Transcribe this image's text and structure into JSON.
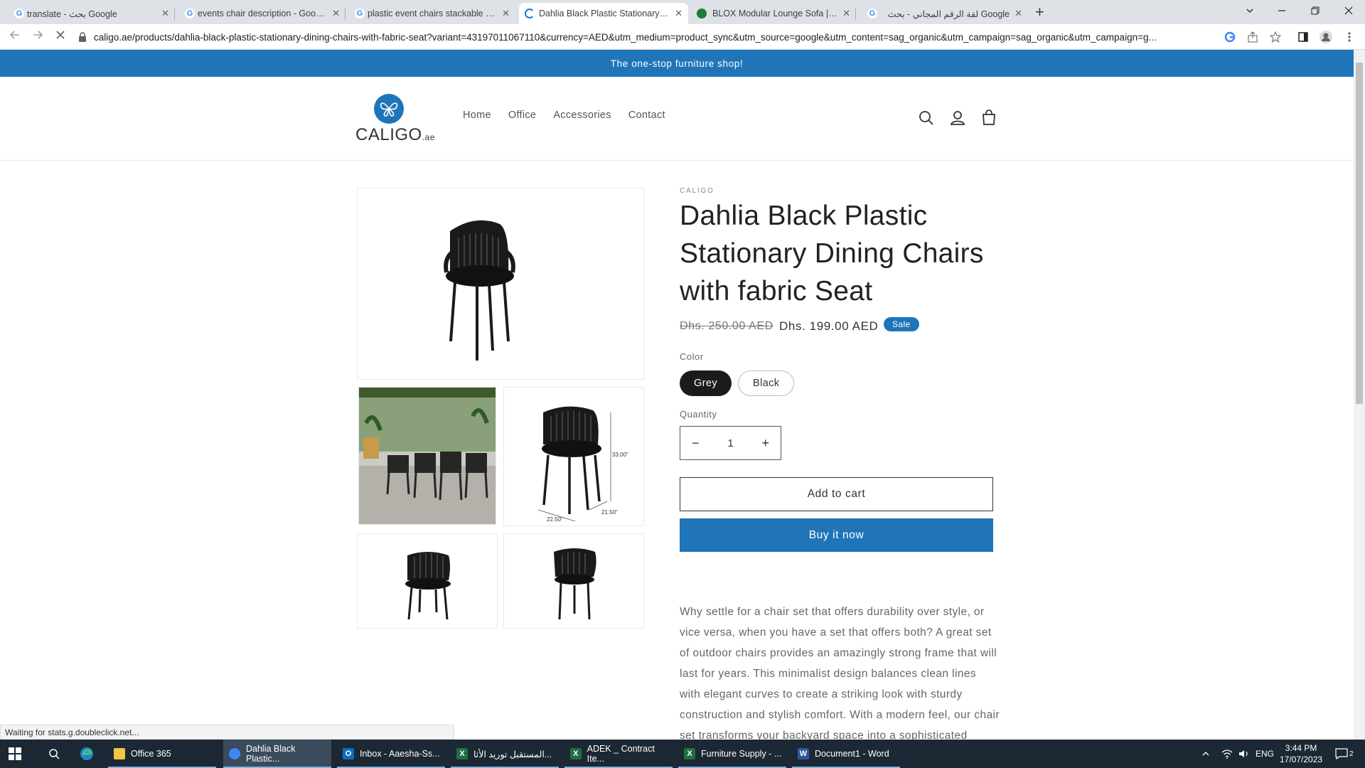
{
  "browser": {
    "tabs": [
      {
        "title": "translate - بحث Google",
        "favicon": "google-icon",
        "active": false
      },
      {
        "title": "events chair description - Google",
        "favicon": "google-icon",
        "active": false
      },
      {
        "title": "plastic event chairs stackable bla",
        "favicon": "google-icon",
        "active": false
      },
      {
        "title": "Dahlia Black Plastic Stationary Di",
        "favicon": "loading-spinner-icon",
        "active": true
      },
      {
        "title": "BLOX Modular Lounge Sofa | Offi",
        "favicon": "sheet-icon",
        "active": false
      },
      {
        "title": "لقة الرقم المجاني - بحث Google",
        "favicon": "google-icon",
        "active": false
      }
    ],
    "close_glyph": "✕",
    "new_tab_glyph": "+",
    "url": "caligo.ae/products/dahlia-black-plastic-stationary-dining-chairs-with-fabric-seat?variant=43197011067110&currency=AED&utm_medium=product_sync&utm_source=google&utm_content=sag_organic&utm_campaign=sag_organic&utm_campaign=g...",
    "status_text": "Waiting for stats.g.doubleclick.net..."
  },
  "site": {
    "announcement": "The one-stop furniture shop!",
    "logo_text": "CALIGO",
    "logo_suffix": ".ae",
    "nav": [
      "Home",
      "Office",
      "Accessories",
      "Contact"
    ]
  },
  "product": {
    "vendor": "CALIGO",
    "title": "Dahlia Black Plastic Stationary Dining Chairs with fabric Seat",
    "price_regular": "Dhs. 250.00 AED",
    "price_sale": "Dhs. 199.00 AED",
    "sale_badge": "Sale",
    "color_label": "Color",
    "colors": [
      {
        "name": "Grey",
        "selected": true
      },
      {
        "name": "Black",
        "selected": false
      }
    ],
    "quantity_label": "Quantity",
    "quantity": "1",
    "qty_minus": "−",
    "qty_plus": "+",
    "add_to_cart": "Add to cart",
    "buy_now": "Buy it now",
    "description": "Why settle for a chair set that offers durability over style, or vice versa, when you have a set that offers both? A great set of outdoor chairs provides an amazingly strong frame that will last for years. This minimalist design balances clean lines with elegant curves to create a striking look with sturdy construction and stylish comfort. With a modern feel, our chair set transforms your backyard space into a sophisticated",
    "dimensions": {
      "height": "33.00\"",
      "width": "22.50\"",
      "depth": "21.50\""
    }
  },
  "taskbar": {
    "apps": [
      {
        "label": "Office 365",
        "icon": "folder-icon",
        "color": "#f2c744",
        "active": false
      },
      {
        "label": "Dahlia Black Plastic...",
        "icon": "chrome-icon",
        "color": "#4285f4",
        "active": true
      },
      {
        "label": "Inbox - Aaesha-Ss...",
        "icon": "outlook-icon",
        "color": "#0f6cbd",
        "active": false
      },
      {
        "label": "المستقبل توريد الأثا...",
        "icon": "excel-icon",
        "color": "#1d6f42",
        "active": false
      },
      {
        "label": "ADEK _ Contract Ite...",
        "icon": "excel-icon",
        "color": "#1d6f42",
        "active": false
      },
      {
        "label": "Furniture Supply - ...",
        "icon": "excel-icon",
        "color": "#1d6f42",
        "active": false
      },
      {
        "label": "Document1 - Word",
        "icon": "word-icon",
        "color": "#2b579a",
        "active": false
      }
    ],
    "language": "ENG",
    "time": "3:44 PM",
    "date": "17/07/2023",
    "notification_count": "2"
  },
  "colors": {
    "brand_blue": "#1f75b8",
    "selected_pill": "#1b1b1b"
  }
}
